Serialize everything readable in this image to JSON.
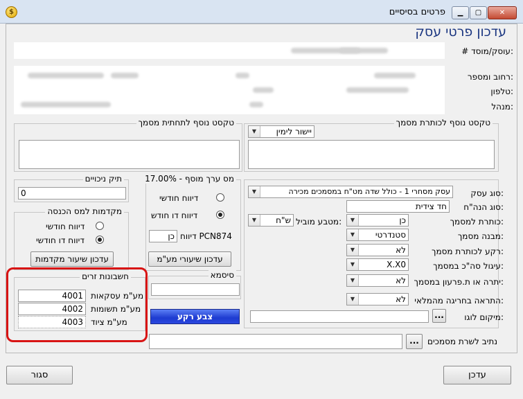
{
  "window": {
    "title": "פרטים בסיסיים",
    "header": "עדכון פרטי עסק"
  },
  "business": {
    "id_label": "# עוסק/מוסד:",
    "street_label": "רחוב ומספר:",
    "phone_label": "טלפון:",
    "manager_label": "מנהל:"
  },
  "header_text": {
    "label": "טקסט נוסף לכותרת מסמך",
    "align_value": "יישור לימין"
  },
  "footer_text": {
    "label": "טקסט נוסף לתחתית מסמך"
  },
  "vat": {
    "label": "מס ערך מוסף - 17.00%",
    "opt_monthly": "דיווח חודשי",
    "opt_bimonthly": "דיווח דו חודש",
    "pcn_label": "דיווח PCN874",
    "pcn_value": "כן",
    "update_button": "עדכון שיעורי מע\"מ"
  },
  "deductions": {
    "label": "תיק ניכויים",
    "value": "0"
  },
  "income_tax": {
    "label": "מקדמות למס הכנסה",
    "opt_monthly": "דיווח חודשי",
    "opt_bimonthly": "דיווח דו חודשי",
    "update_button": "עדכון שיעור מקדמות"
  },
  "foreign_accounts": {
    "label": "חשבונות זרים",
    "rows": [
      {
        "label": "מע\"מ עסקאות",
        "value": "4001"
      },
      {
        "label": "מע\"מ תשומות",
        "value": "4002"
      },
      {
        "label": "מע\"מ ציוד",
        "value": "4003"
      }
    ]
  },
  "password": {
    "label": "סיסמא",
    "value": ""
  },
  "color_button": "צבע רקע",
  "settings": {
    "business_type_label": "סוג עסק:",
    "business_type_value": "עסק מסחרי 1 - כולל שדה מט\"ח במסמכים מכירה",
    "bookkeeping_label": "סוג הנה\"ח:",
    "bookkeeping_value": "חד צידית",
    "doc_title_label": "כותרת למסמך:",
    "doc_title_value": "כן",
    "currency_label": "מטבע מוביל:",
    "currency_value": "ש\"ח",
    "doc_structure_label": "מבנה מסמך:",
    "doc_structure_value": "סטנדרטי",
    "bg_title_label": "רקע לכותרת מסמך:",
    "bg_title_value": "לא",
    "rounding_label": "עיגול סה\"כ במסמך:",
    "rounding_value": "X.X0",
    "balance_label": "יתרה או ת.פרעון במסמך:",
    "balance_value": "לא",
    "stock_alert_label": "התראה בחריגה מהמלאי:",
    "stock_alert_value": "לא",
    "logo_label": "מיקום לוגו:",
    "logo_value": ""
  },
  "docs_path": {
    "label": "נתיב לשרת מסמכים",
    "value": ""
  },
  "ellipsis": "...",
  "buttons": {
    "update": "עדכן",
    "close": "סגור"
  }
}
